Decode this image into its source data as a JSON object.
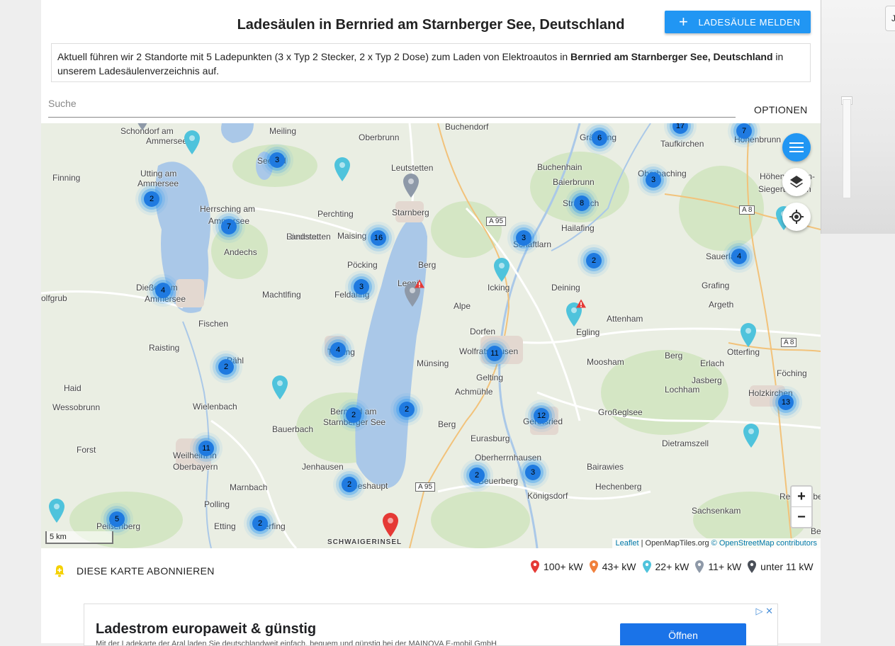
{
  "header": {
    "title": "Ladesäulen in Bernried am Starnberger See, Deutschland",
    "report_button": "LADESÄULE MELDEN"
  },
  "description": {
    "part1": "Aktuell führen wir 2 Standorte mit 5 Ladepunkten (3 x Typ 2 Stecker, 2 x Typ 2 Dose) zum Laden von Elektroautos in ",
    "place": "Bernried am Starnberger See, Deutschland",
    "part2": " in unserem Ladesäulenverzeichnis auf."
  },
  "search": {
    "placeholder": "Suche"
  },
  "options_label": "OPTIONEN",
  "map": {
    "scale_label": "5 km",
    "attribution": {
      "leaflet": "Leaflet",
      "tiles": " | OpenMapTiles.org ",
      "osm": "© OpenStreetMap contributors"
    },
    "zoom_in": "+",
    "zoom_out": "−",
    "labels": [
      "Schondorf am",
      "Ammersee",
      "Meiling",
      "Oberbrunn",
      "Buchendorf",
      "Gräfelfing",
      "Taufkirchen",
      "Hohenbrunn",
      "Utting am",
      "Ammersee",
      "Finning",
      "Seefeld",
      "Leutstetten",
      "Buchenhain",
      "Baierbrunn",
      "Oberhaching",
      "Höhenkirchen-",
      "Siegertsbrunn",
      "Herrsching am",
      "Ammersee",
      "Perchting",
      "Starnberg",
      "Straßlach",
      "Hailafing",
      "Riederau",
      "Andechs",
      "Landstetten",
      "Maising",
      "Schäftlarn",
      "Sauerlach",
      "Pöcking",
      "Berg",
      "Leoni",
      "Deining",
      "Grafing",
      "Dießen am",
      "Ammersee",
      "Machtlfing",
      "Feldafing",
      "Alpe",
      "Icking",
      "Argeth",
      "olfgrub",
      "Attenham",
      "Fischen",
      "Dorfen",
      "Egling",
      "Wolfratshausen",
      "Raisting",
      "Tutzing",
      "Münsing",
      "Gelting",
      "Moosham",
      "Berg",
      "Erlach",
      "Otterfing",
      "Pähl",
      "Achmühle",
      "Föching",
      "Haid",
      "Jasberg",
      "Holzkirchen",
      "Wessobrunn",
      "Wielenbach",
      "Bernried am",
      "Starnberger See",
      "Berg",
      "Großeglsee",
      "Lochham",
      "Bauerbach",
      "Eurasburg",
      "Geretsried",
      "Forst",
      "Weilheim in",
      "Oberbayern",
      "Dietramszell",
      "Jenhausen",
      "Oberherrnhausen",
      "Bairawies",
      "Marnbach",
      "Seeshaupt",
      "Beuerberg",
      "Königsdorf",
      "Hechenberg",
      "Polling",
      "Sachsenkam",
      "Peißenberg",
      "Etting",
      "Eberfing",
      "SCHWAIGERINSEL",
      "Reichersbeuern",
      "Berg"
    ],
    "highways": [
      "A 95",
      "A 8",
      "A 8",
      "A 95"
    ],
    "clusters": [
      "3",
      "17",
      "7",
      "6",
      "3",
      "2",
      "8",
      "7",
      "16",
      "3",
      "2",
      "4",
      "4",
      "3",
      "11",
      "2",
      "4",
      "2",
      "12",
      "2",
      "2",
      "13",
      "11",
      "2",
      "3",
      "5",
      "2"
    ]
  },
  "subscribe_label": "DIESE KARTE ABONNIEREN",
  "legend": [
    {
      "label": "100+ kW",
      "color": "#e53935"
    },
    {
      "label": "43+ kW",
      "color": "#f0803c"
    },
    {
      "label": "22+ kW",
      "color": "#4fc3dc"
    },
    {
      "label": "11+ kW",
      "color": "#8e99a8"
    },
    {
      "label": "unter 11 kW",
      "color": "#4a4f58"
    }
  ],
  "ad": {
    "headline": "Ladestrom europaweit & günstig",
    "sub": "Mit der Ladekarte der Aral laden Sie deutschlandweit einfach, bequem und günstig bei der MAINOVA E-mobil GmbH",
    "button": "Öffnen"
  },
  "rightstrip": {
    "label": "J"
  }
}
